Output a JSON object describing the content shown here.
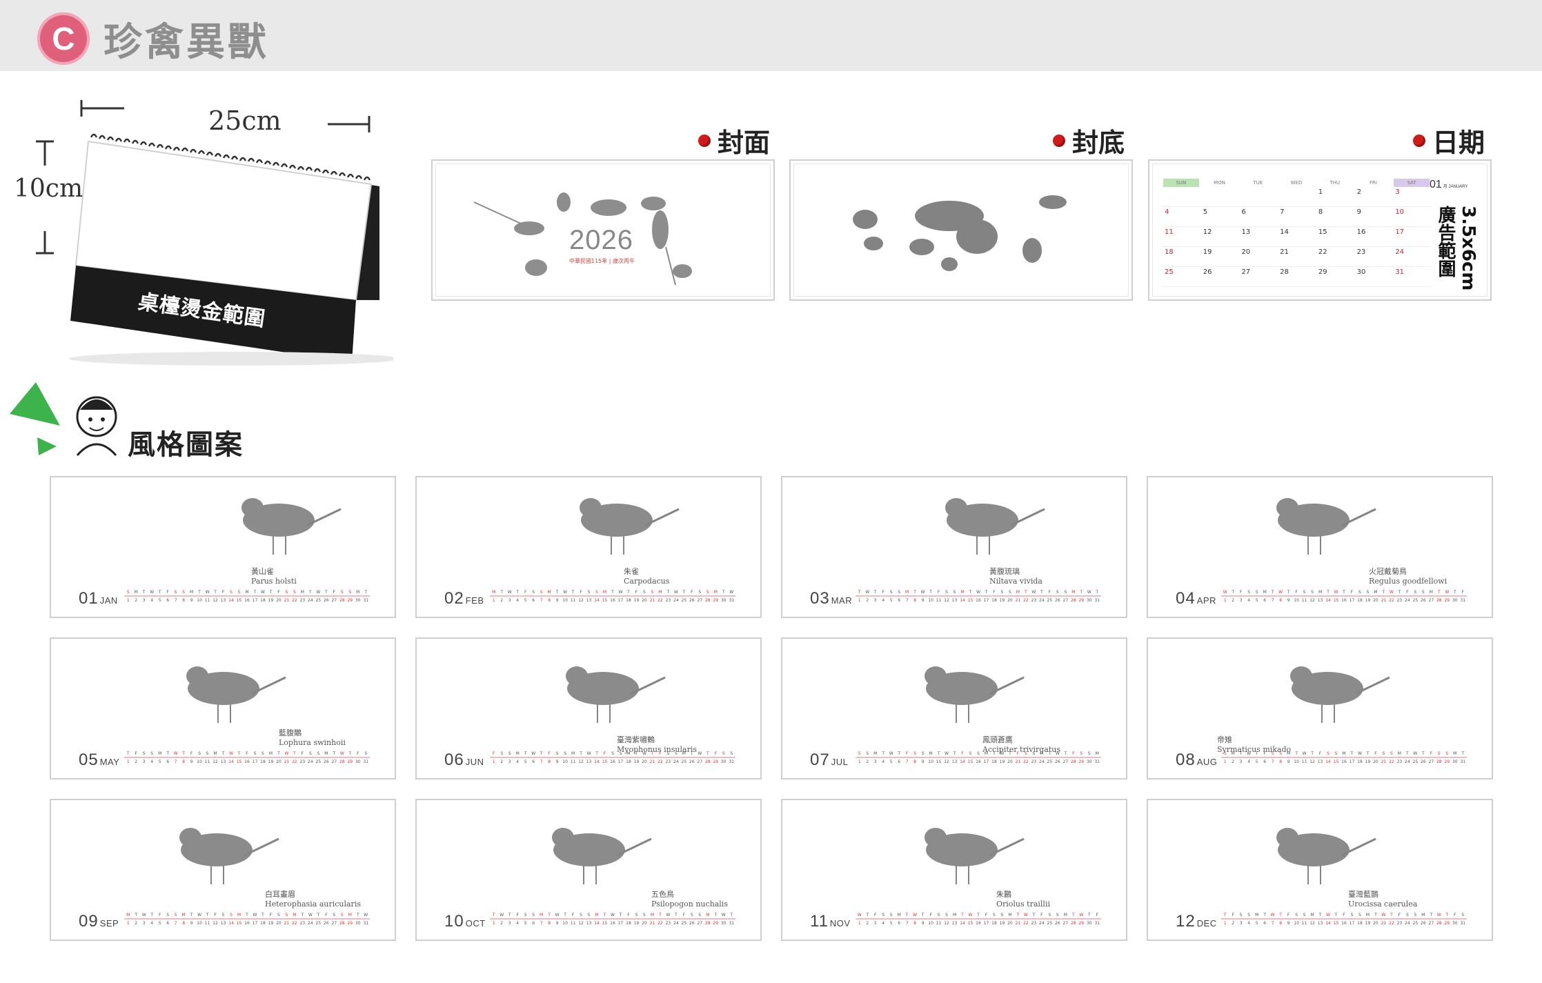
{
  "header": {
    "badge_letter": "C",
    "title": "珍禽異獸"
  },
  "product": {
    "width_label": "25cm",
    "height_label": "10cm",
    "base_text": "桌檯燙金範圍"
  },
  "panels": {
    "cover_label": "封面",
    "back_label": "封底",
    "date_label": "日期",
    "cover_year": "2026",
    "cover_sub": "中華民國115年 | 歲次丙午",
    "ad_area": [
      "3.5x6cm",
      "廣告範圍"
    ],
    "date_month_num": "01",
    "date_month_sub": "月 JANUARY",
    "date_headers": [
      "SUN",
      "MON",
      "TUE",
      "WED",
      "THU",
      "FRI",
      "SAT"
    ],
    "date_rows": [
      [
        "",
        "",
        "",
        "",
        "1",
        "2",
        "3"
      ],
      [
        "4",
        "5",
        "6",
        "7",
        "8",
        "9",
        "10"
      ],
      [
        "11",
        "12",
        "13",
        "14",
        "15",
        "16",
        "17"
      ],
      [
        "18",
        "19",
        "20",
        "21",
        "22",
        "23",
        "24"
      ],
      [
        "25",
        "26",
        "27",
        "28",
        "29",
        "30",
        "31"
      ]
    ]
  },
  "style_section": {
    "title": "風格圖案"
  },
  "months": [
    {
      "num": "01",
      "abbr": "JAN",
      "zh": "黃山雀",
      "latin": "Parus holsti"
    },
    {
      "num": "02",
      "abbr": "FEB",
      "zh": "朱雀",
      "latin": "Carpodacus"
    },
    {
      "num": "03",
      "abbr": "MAR",
      "zh": "黃腹琉璃",
      "latin": "Niltava vivida"
    },
    {
      "num": "04",
      "abbr": "APR",
      "zh": "火冠戴菊鳥",
      "latin": "Regulus goodfellowi"
    },
    {
      "num": "05",
      "abbr": "MAY",
      "zh": "藍腹鷴",
      "latin": "Lophura swinhoii"
    },
    {
      "num": "06",
      "abbr": "JUN",
      "zh": "臺灣紫嘯鶇",
      "latin": "Myophonus insularis"
    },
    {
      "num": "07",
      "abbr": "JUL",
      "zh": "鳳頭蒼鷹",
      "latin": "Accipiter trivirgatus"
    },
    {
      "num": "08",
      "abbr": "AUG",
      "zh": "帝雉",
      "latin": "Syrmaticus mikado"
    },
    {
      "num": "09",
      "abbr": "SEP",
      "zh": "白耳畫眉",
      "latin": "Heterophasia auricularis"
    },
    {
      "num": "10",
      "abbr": "OCT",
      "zh": "五色鳥",
      "latin": "Psilopogon nuchalis"
    },
    {
      "num": "11",
      "abbr": "NOV",
      "zh": "朱鸝",
      "latin": "Oriolus traillii"
    },
    {
      "num": "12",
      "abbr": "DEC",
      "zh": "臺灣藍鵲",
      "latin": "Urocissa caerulea"
    }
  ]
}
